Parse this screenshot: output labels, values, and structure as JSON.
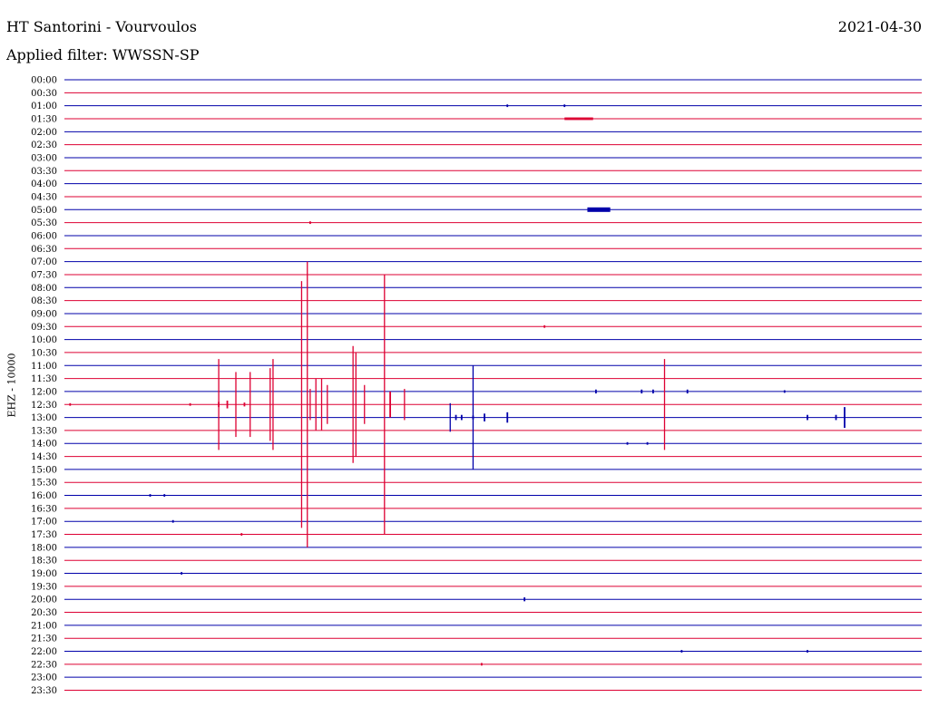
{
  "header": {
    "station": "HT Santorini - Vourvoulos",
    "date": "2021-04-30",
    "filter": "Applied filter: WWSSN-SP"
  },
  "colors": {
    "blue_trace": "#0000aa",
    "red_trace": "#dd0033"
  },
  "chart_data": {
    "type": "line",
    "title": "HT Santorini - Vourvoulos",
    "ylabel": "EHZ - 10000",
    "xlabel": "",
    "tick_labels": [
      "00:00",
      "00:30",
      "01:00",
      "01:30",
      "02:00",
      "02:30",
      "03:00",
      "03:30",
      "04:00",
      "04:30",
      "05:00",
      "05:30",
      "06:00",
      "06:30",
      "07:00",
      "07:30",
      "08:00",
      "08:30",
      "09:00",
      "09:30",
      "10:00",
      "10:30",
      "11:00",
      "11:30",
      "12:00",
      "12:30",
      "13:00",
      "13:30",
      "14:00",
      "14:30",
      "15:00",
      "15:30",
      "16:00",
      "16:30",
      "17:00",
      "17:30",
      "18:00",
      "18:30",
      "19:00",
      "19:30",
      "20:00",
      "20:30",
      "21:00",
      "21:30",
      "22:00",
      "22:30",
      "23:00",
      "23:30"
    ],
    "minutes_per_row": 30,
    "row_colors": [
      "blue",
      "red"
    ],
    "events": [
      {
        "row": 2,
        "minute": 15.5,
        "amp": 0.1
      },
      {
        "row": 2,
        "minute": 17.5,
        "amp": 0.1
      },
      {
        "row": 3,
        "minute": 18.0,
        "amp": 0.2,
        "duration": 1.0
      },
      {
        "row": 10,
        "minute": 18.7,
        "amp": 0.35,
        "duration": 0.8
      },
      {
        "row": 11,
        "minute": 8.6,
        "amp": 0.1
      },
      {
        "row": 19,
        "minute": 16.8,
        "amp": 0.1
      },
      {
        "row": 24,
        "minute": 18.6,
        "amp": 0.15
      },
      {
        "row": 24,
        "minute": 20.2,
        "amp": 0.15
      },
      {
        "row": 24,
        "minute": 20.6,
        "amp": 0.15
      },
      {
        "row": 24,
        "minute": 21.8,
        "amp": 0.15
      },
      {
        "row": 24,
        "minute": 25.2,
        "amp": 0.1
      },
      {
        "row": 25,
        "minute": 0.2,
        "amp": 0.1
      },
      {
        "row": 25,
        "minute": 4.4,
        "amp": 0.1
      },
      {
        "row": 25,
        "minute": 5.4,
        "amp": 0.2
      },
      {
        "row": 25,
        "minute": 5.7,
        "amp": 0.3
      },
      {
        "row": 25,
        "minute": 6.3,
        "amp": 0.15
      },
      {
        "row": 25,
        "minute": 5.4,
        "amp": 3.5
      },
      {
        "row": 25,
        "minute": 6.0,
        "amp": 2.5
      },
      {
        "row": 25,
        "minute": 6.5,
        "amp": 2.5
      },
      {
        "row": 25,
        "minute": 7.2,
        "amp": 2.8
      },
      {
        "row": 25,
        "minute": 7.3,
        "amp": 3.5
      },
      {
        "row": 25,
        "minute": 8.3,
        "amp": 9.5
      },
      {
        "row": 25,
        "minute": 8.5,
        "amp": 11.0
      },
      {
        "row": 25,
        "minute": 8.6,
        "amp": 1.2
      },
      {
        "row": 25,
        "minute": 8.8,
        "amp": 2.0
      },
      {
        "row": 25,
        "minute": 9.0,
        "amp": 2.0
      },
      {
        "row": 25,
        "minute": 9.2,
        "amp": 1.5
      },
      {
        "row": 25,
        "minute": 10.1,
        "amp": 4.5
      },
      {
        "row": 25,
        "minute": 10.2,
        "amp": 4.0
      },
      {
        "row": 25,
        "minute": 10.5,
        "amp": 1.5
      },
      {
        "row": 25,
        "minute": 11.2,
        "amp": 10.0
      },
      {
        "row": 25,
        "minute": 11.4,
        "amp": 1.0
      },
      {
        "row": 25,
        "minute": 11.9,
        "amp": 1.2
      },
      {
        "row": 25,
        "minute": 21.0,
        "amp": 3.5
      },
      {
        "row": 26,
        "minute": 13.7,
        "amp": 0.2
      },
      {
        "row": 26,
        "minute": 13.9,
        "amp": 0.2
      },
      {
        "row": 26,
        "minute": 14.3,
        "amp": 0.15
      },
      {
        "row": 26,
        "minute": 14.7,
        "amp": 0.3
      },
      {
        "row": 26,
        "minute": 15.5,
        "amp": 0.4
      },
      {
        "row": 26,
        "minute": 26.0,
        "amp": 0.2
      },
      {
        "row": 26,
        "minute": 27.0,
        "amp": 0.2
      },
      {
        "row": 26,
        "minute": 27.3,
        "amp": 0.8
      },
      {
        "row": 26,
        "minute": 13.5,
        "amp": 1.1
      },
      {
        "row": 26,
        "minute": 14.3,
        "amp": 4.0
      },
      {
        "row": 28,
        "minute": 19.7,
        "amp": 0.1
      },
      {
        "row": 28,
        "minute": 20.4,
        "amp": 0.1
      },
      {
        "row": 32,
        "minute": 3.0,
        "amp": 0.1
      },
      {
        "row": 32,
        "minute": 3.5,
        "amp": 0.1
      },
      {
        "row": 34,
        "minute": 3.8,
        "amp": 0.1
      },
      {
        "row": 35,
        "minute": 6.2,
        "amp": 0.1
      },
      {
        "row": 38,
        "minute": 4.1,
        "amp": 0.1
      },
      {
        "row": 40,
        "minute": 16.1,
        "amp": 0.15
      },
      {
        "row": 44,
        "minute": 21.6,
        "amp": 0.1
      },
      {
        "row": 44,
        "minute": 26.0,
        "amp": 0.1
      },
      {
        "row": 45,
        "minute": 14.6,
        "amp": 0.1
      }
    ]
  }
}
